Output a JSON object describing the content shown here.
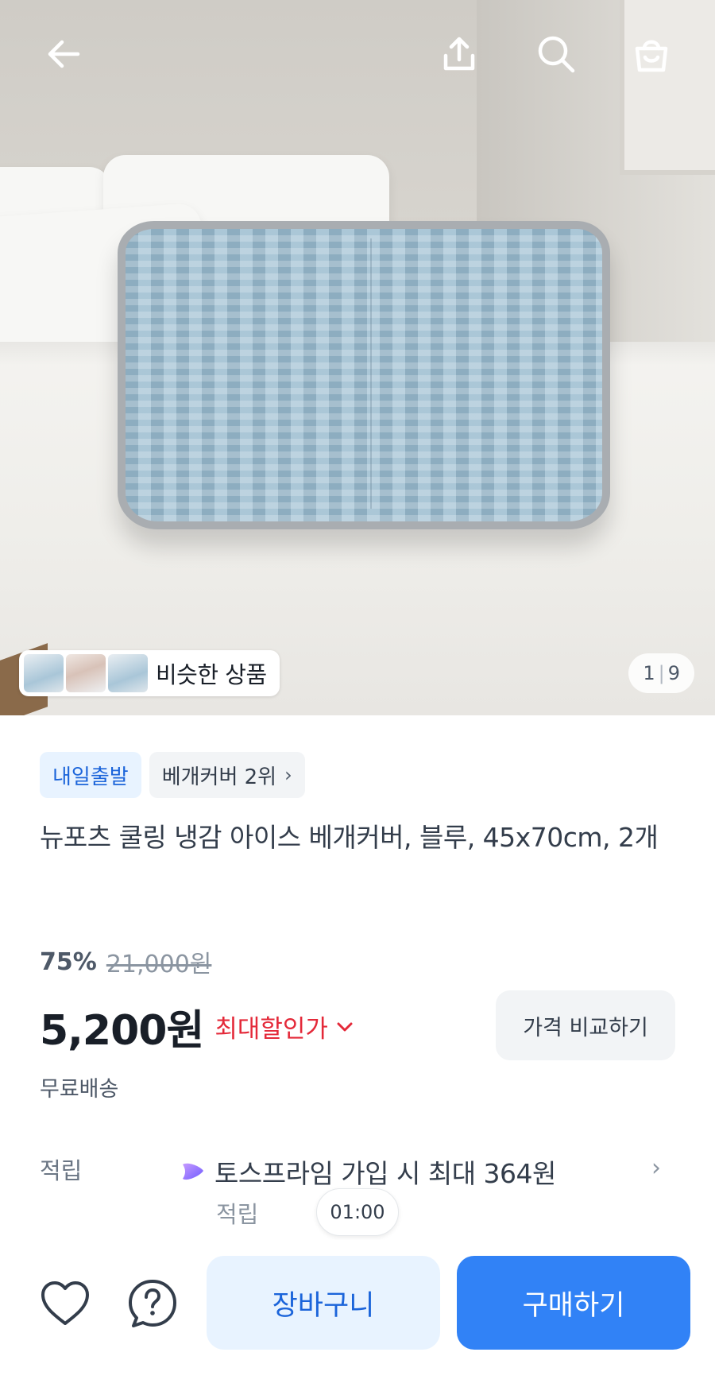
{
  "header": {
    "back_icon": "arrow-left-icon",
    "share_icon": "share-icon",
    "search_icon": "search-icon",
    "cart_icon": "shopping-bag-icon"
  },
  "gallery": {
    "similar_label": "비슷한 상품",
    "page_current": "1",
    "page_total": "9"
  },
  "tags": {
    "delivery": "내일출발",
    "ranking": "베개커버 2위"
  },
  "product": {
    "title": "뉴포츠 쿨링 냉감 아이스 베개커버, 블루, 45x70cm, 2개",
    "discount_rate": "75%",
    "original_price": "21,000원",
    "price": "5,200원",
    "max_discount_label": "최대할인가",
    "compare_label": "가격 비교하기",
    "shipping": "무료배송"
  },
  "points": {
    "label": "적립",
    "text": "토스프라임 가입 시 최대 364원",
    "text_cont": "적립",
    "timer": "01:00"
  },
  "actions": {
    "cart": "장바구니",
    "buy": "구매하기"
  },
  "colors": {
    "primary": "#3182f6",
    "primary_light": "#e8f3ff",
    "discount_red": "#e42939"
  }
}
